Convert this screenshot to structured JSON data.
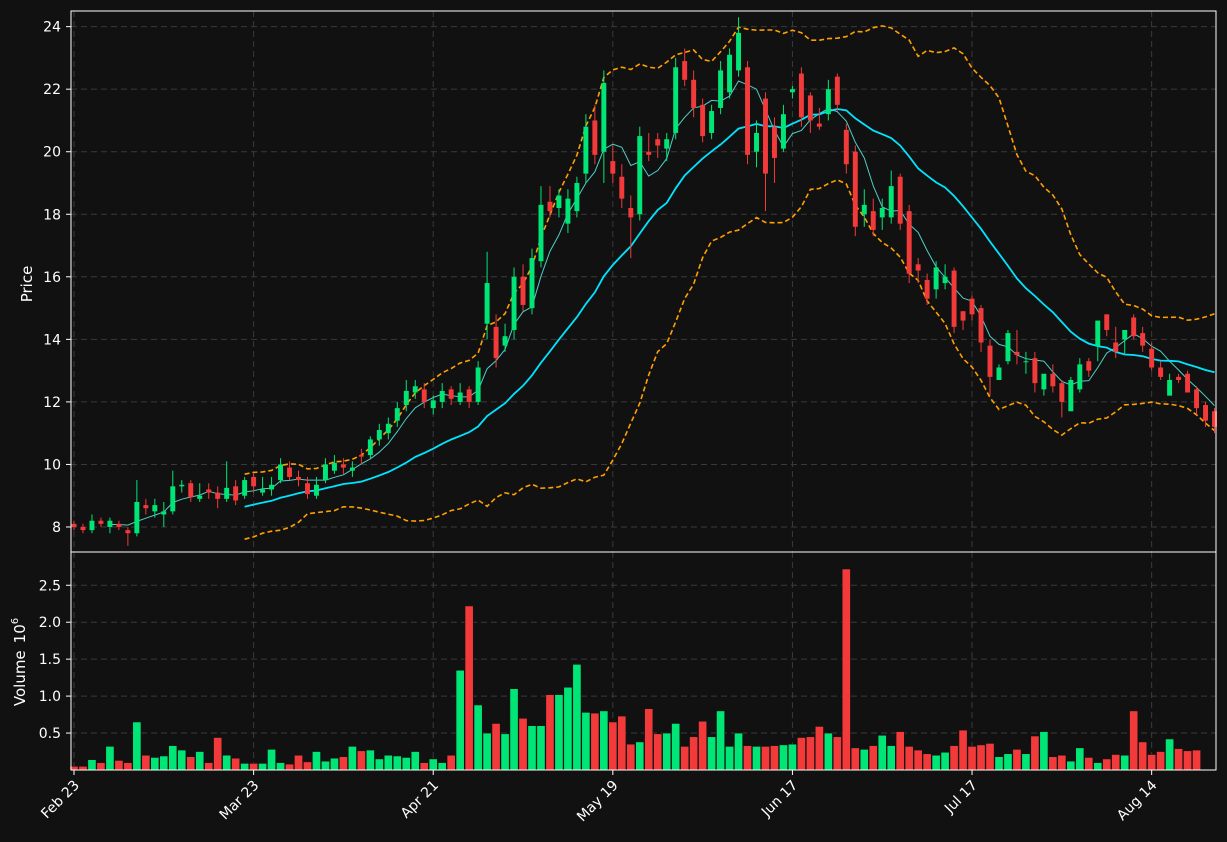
{
  "chart_data": {
    "type": "candlestick",
    "price_panel": {
      "ylabel": "Price",
      "ylim": [
        7.2,
        24.5
      ],
      "yticks": [
        8,
        10,
        12,
        14,
        16,
        18,
        20,
        22,
        24
      ]
    },
    "volume_panel": {
      "ylabel": "Volume",
      "scale_label": "10",
      "scale_exponent": "6",
      "ylim": [
        0,
        2.95
      ],
      "yticks": [
        0.5,
        1.0,
        1.5,
        2.0,
        2.5
      ],
      "ytick_labels": [
        "0.5",
        "1.0",
        "1.5",
        "2.0",
        "2.5"
      ]
    },
    "xticks": [
      {
        "label": "Feb 23",
        "index": 0
      },
      {
        "label": "Mar 23",
        "index": 20
      },
      {
        "label": "Apr 21",
        "index": 40
      },
      {
        "label": "May 19",
        "index": 60
      },
      {
        "label": "Jun 17",
        "index": 80
      },
      {
        "label": "Jul 17",
        "index": 100
      },
      {
        "label": "Aug 14",
        "index": 120
      }
    ],
    "up_color": "#00e676",
    "down_color": "#f23a3a",
    "ma_short_color": "#4dd0c8",
    "ma_long_color": "#00e5ff",
    "band_color": "#ffa000",
    "grid": true,
    "ma_short_window": 5,
    "ma_long_window": 20,
    "close": [
      8.0,
      7.9,
      8.2,
      8.1,
      8.2,
      8.0,
      7.8,
      8.8,
      8.6,
      8.7,
      8.5,
      9.3,
      9.35,
      8.95,
      9.0,
      9.1,
      8.9,
      9.25,
      8.85,
      9.5,
      9.3,
      9.2,
      9.35,
      10.0,
      9.6,
      9.5,
      9.05,
      9.35,
      10.0,
      10.05,
      9.9,
      9.9,
      10.25,
      10.8,
      11.1,
      11.3,
      11.8,
      12.35,
      12.5,
      12.0,
      12.05,
      12.35,
      12.1,
      12.3,
      12.0,
      13.1,
      15.8,
      13.4,
      14.1,
      16.0,
      15.1,
      16.6,
      18.3,
      18.1,
      18.6,
      18.5,
      19.0,
      20.8,
      19.9,
      22.2,
      19.3,
      18.5,
      17.9,
      20.5,
      19.9,
      20.2,
      20.4,
      22.7,
      22.3,
      21.4,
      20.5,
      21.3,
      22.6,
      23.1,
      23.8,
      19.9,
      20.6,
      19.3,
      19.8,
      21.2,
      22.0,
      21.1,
      21.0,
      20.8,
      22.0,
      21.5,
      19.6,
      17.6,
      18.3,
      17.5,
      18.2,
      18.9,
      17.7,
      16.1,
      16.2,
      15.3,
      16.3,
      16.0,
      14.4,
      14.6,
      14.8,
      13.9,
      12.8,
      13.1,
      14.2,
      13.5,
      13.3,
      12.6,
      12.9,
      12.5,
      12.0,
      12.7,
      13.2,
      13.0,
      14.6,
      14.3,
      13.6,
      14.3,
      14.1,
      13.8,
      13.1,
      12.8,
      12.7,
      12.7,
      12.3,
      11.8,
      11.4,
      11.2
    ],
    "open": [
      8.1,
      8.0,
      7.9,
      8.2,
      8.0,
      8.1,
      7.9,
      7.8,
      8.7,
      8.5,
      8.4,
      8.5,
      9.3,
      9.4,
      8.9,
      9.2,
      9.1,
      8.9,
      9.3,
      9.0,
      9.6,
      9.1,
      9.2,
      9.5,
      9.9,
      9.6,
      9.4,
      9.0,
      9.5,
      9.8,
      10.0,
      9.8,
      10.3,
      10.3,
      10.8,
      11.0,
      11.4,
      11.9,
      12.3,
      12.4,
      11.8,
      12.0,
      12.4,
      12.0,
      12.4,
      12.0,
      14.5,
      14.4,
      13.8,
      14.3,
      16.0,
      15.0,
      16.5,
      18.4,
      18.2,
      17.7,
      18.1,
      19.3,
      21.0,
      20.0,
      19.7,
      19.2,
      18.2,
      18.0,
      20.0,
      20.4,
      20.1,
      20.6,
      22.9,
      22.3,
      21.5,
      20.6,
      21.4,
      21.9,
      22.6,
      22.7,
      20.0,
      21.7,
      20.8,
      20.1,
      21.9,
      22.5,
      21.8,
      20.9,
      21.2,
      22.4,
      20.7,
      20.0,
      18.0,
      18.1,
      17.9,
      17.9,
      19.2,
      18.1,
      16.4,
      15.9,
      15.6,
      15.8,
      16.2,
      14.9,
      15.3,
      15.0,
      13.8,
      12.7,
      13.3,
      13.6,
      13.3,
      13.4,
      12.4,
      12.9,
      12.6,
      11.7,
      12.4,
      13.3,
      13.8,
      14.8,
      13.9,
      14.0,
      14.7,
      14.2,
      13.7,
      13.1,
      12.2,
      12.8,
      12.9,
      12.4,
      11.9,
      11.7
    ],
    "high": [
      8.2,
      8.1,
      8.4,
      8.3,
      8.3,
      8.2,
      8.0,
      9.5,
      8.9,
      8.9,
      8.8,
      9.8,
      9.5,
      9.5,
      9.4,
      9.4,
      9.3,
      10.1,
      9.5,
      9.6,
      9.7,
      9.6,
      9.6,
      10.2,
      10.1,
      9.8,
      9.6,
      9.6,
      10.2,
      10.3,
      10.2,
      10.1,
      10.5,
      10.9,
      11.3,
      11.5,
      12.0,
      12.7,
      12.7,
      12.6,
      12.2,
      12.6,
      12.5,
      12.6,
      12.5,
      13.3,
      16.8,
      14.8,
      14.5,
      16.3,
      16.4,
      16.9,
      18.9,
      18.9,
      18.8,
      18.8,
      19.2,
      21.2,
      21.5,
      22.6,
      20.2,
      19.6,
      18.6,
      20.8,
      20.6,
      20.6,
      20.6,
      23.0,
      23.3,
      22.6,
      21.7,
      21.5,
      22.9,
      23.3,
      24.3,
      22.9,
      21.0,
      21.9,
      21.1,
      21.5,
      22.1,
      22.7,
      21.9,
      21.4,
      22.3,
      22.5,
      20.9,
      20.2,
      18.8,
      18.5,
      18.5,
      19.4,
      19.3,
      18.3,
      16.6,
      16.1,
      16.5,
      16.4,
      16.3,
      14.9,
      15.4,
      15.1,
      14.0,
      13.2,
      14.3,
      14.3,
      13.6,
      13.6,
      12.8,
      13.2,
      12.7,
      12.8,
      13.4,
      13.4,
      13.9,
      14.8,
      14.4,
      14.1,
      14.8,
      14.4,
      13.9,
      13.3,
      12.9,
      12.9,
      13.0,
      12.5,
      12.0,
      11.8
    ],
    "low": [
      7.9,
      7.8,
      7.8,
      8.0,
      7.8,
      7.9,
      7.4,
      7.7,
      8.4,
      8.3,
      8.0,
      8.4,
      9.1,
      8.8,
      8.8,
      8.9,
      8.6,
      8.8,
      8.7,
      8.9,
      9.1,
      9.0,
      9.0,
      9.4,
      9.5,
      9.3,
      8.9,
      8.9,
      9.4,
      9.7,
      9.7,
      9.6,
      10.0,
      10.2,
      10.6,
      10.8,
      11.2,
      11.7,
      12.1,
      11.8,
      11.6,
      11.8,
      11.9,
      11.9,
      11.8,
      11.9,
      14.0,
      13.1,
      13.6,
      14.0,
      14.9,
      14.8,
      16.3,
      17.9,
      17.9,
      17.4,
      17.9,
      19.0,
      19.6,
      19.0,
      19.0,
      18.2,
      16.6,
      17.8,
      19.7,
      19.8,
      19.7,
      20.4,
      22.1,
      21.1,
      20.3,
      20.4,
      21.2,
      21.7,
      22.4,
      19.6,
      19.5,
      18.1,
      19.0,
      20.0,
      21.7,
      20.8,
      20.6,
      20.7,
      21.0,
      21.3,
      19.3,
      17.3,
      17.6,
      17.3,
      17.5,
      17.7,
      17.5,
      15.8,
      15.8,
      15.1,
      15.3,
      15.6,
      14.2,
      14.3,
      14.6,
      13.6,
      12.2,
      12.7,
      13.2,
      13.2,
      12.9,
      12.3,
      12.2,
      12.3,
      11.5,
      11.9,
      12.3,
      12.8,
      13.3,
      14.1,
      13.4,
      13.5,
      14.0,
      13.6,
      13.0,
      12.7,
      12.4,
      12.6,
      12.3,
      11.6,
      11.2,
      11.0
    ],
    "volume": [
      0.05,
      0.05,
      0.14,
      0.1,
      0.32,
      0.13,
      0.1,
      0.65,
      0.2,
      0.17,
      0.19,
      0.33,
      0.27,
      0.18,
      0.25,
      0.1,
      0.44,
      0.2,
      0.16,
      0.09,
      0.09,
      0.09,
      0.28,
      0.1,
      0.08,
      0.2,
      0.11,
      0.25,
      0.12,
      0.16,
      0.18,
      0.32,
      0.26,
      0.27,
      0.15,
      0.2,
      0.19,
      0.17,
      0.25,
      0.1,
      0.15,
      0.1,
      0.2,
      1.35,
      2.22,
      0.88,
      0.5,
      0.63,
      0.49,
      1.1,
      0.7,
      0.6,
      0.6,
      1.02,
      1.02,
      1.12,
      1.43,
      0.78,
      0.77,
      0.8,
      0.65,
      0.73,
      0.35,
      0.38,
      0.83,
      0.49,
      0.5,
      0.63,
      0.32,
      0.45,
      0.66,
      0.45,
      0.8,
      0.32,
      0.5,
      0.33,
      0.32,
      0.32,
      0.33,
      0.34,
      0.35,
      0.44,
      0.45,
      0.59,
      0.5,
      0.45,
      2.72,
      0.3,
      0.28,
      0.33,
      0.47,
      0.33,
      0.52,
      0.32,
      0.27,
      0.22,
      0.2,
      0.24,
      0.33,
      0.54,
      0.32,
      0.34,
      0.36,
      0.18,
      0.22,
      0.28,
      0.22,
      0.46,
      0.52,
      0.18,
      0.2,
      0.12,
      0.3,
      0.17,
      0.1,
      0.15,
      0.21,
      0.2,
      0.8,
      0.38,
      0.21,
      0.25,
      0.42,
      0.29,
      0.26,
      0.27
    ]
  }
}
